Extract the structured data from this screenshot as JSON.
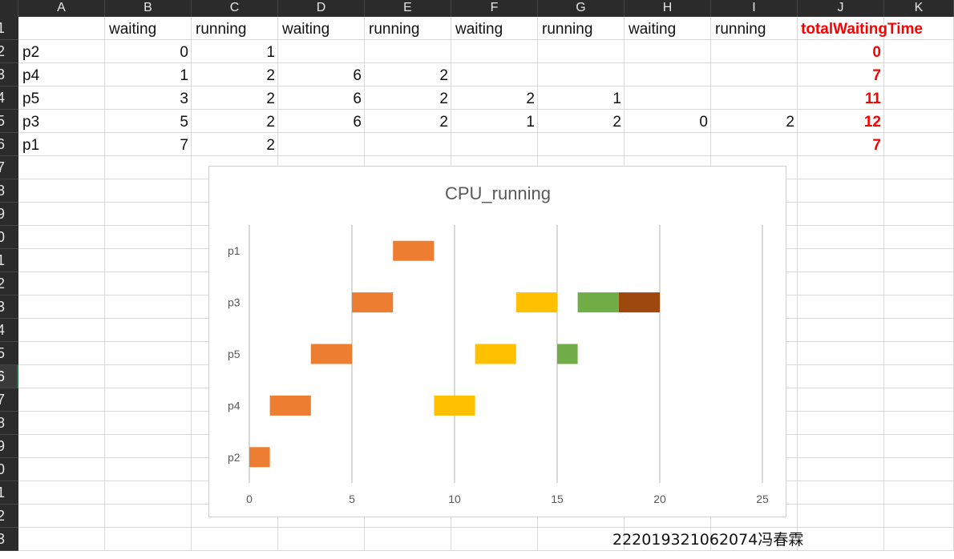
{
  "columns": [
    "A",
    "B",
    "C",
    "D",
    "E",
    "F",
    "G",
    "H",
    "I",
    "J",
    "K"
  ],
  "rows": [
    "1",
    "2",
    "3",
    "4",
    "5",
    "6",
    "7",
    "8",
    "9",
    "0",
    "1",
    "2",
    "3",
    "4",
    "5",
    "6",
    "7",
    "8",
    "9",
    "0",
    "1",
    "2",
    "3"
  ],
  "header_row": [
    "",
    "waiting",
    "running",
    "waiting",
    "running",
    "waiting",
    "running",
    "waiting",
    "running",
    "totalWaitingTime"
  ],
  "table": [
    {
      "name": "p2",
      "values": [
        "0",
        "1",
        "",
        "",
        "",
        "",
        "",
        ""
      ],
      "total": "0"
    },
    {
      "name": "p4",
      "values": [
        "1",
        "2",
        "6",
        "2",
        "",
        "",
        "",
        ""
      ],
      "total": "7"
    },
    {
      "name": "p5",
      "values": [
        "3",
        "2",
        "6",
        "2",
        "2",
        "1",
        "",
        ""
      ],
      "total": "11"
    },
    {
      "name": "p3",
      "values": [
        "5",
        "2",
        "6",
        "2",
        "1",
        "2",
        "0",
        "2"
      ],
      "total": "12"
    },
    {
      "name": "p1",
      "values": [
        "7",
        "2",
        "",
        "",
        "",
        "",
        "",
        ""
      ],
      "total": "7"
    }
  ],
  "signature": "222019321062074冯春霖",
  "colors": {
    "c1": "#ED7D31",
    "c2": "#FFC000",
    "c3": "#70AD47",
    "c4": "#9E480E",
    "total": "#FF0000"
  },
  "chart_data": {
    "type": "bar",
    "orientation": "horizontal-stacked",
    "title": "CPU_running",
    "categories": [
      "p2",
      "p4",
      "p5",
      "p3",
      "p1"
    ],
    "xlim": [
      0,
      25
    ],
    "xticks": [
      "0",
      "5",
      "10",
      "15",
      "20",
      "25"
    ],
    "grid": true,
    "legend": "none",
    "segments": [
      {
        "category": "p2",
        "start": 0,
        "duration": 1,
        "color": "#ED7D31"
      },
      {
        "category": "p4",
        "start": 1,
        "duration": 2,
        "color": "#ED7D31"
      },
      {
        "category": "p4",
        "start": 9,
        "duration": 2,
        "color": "#FFC000"
      },
      {
        "category": "p5",
        "start": 3,
        "duration": 2,
        "color": "#ED7D31"
      },
      {
        "category": "p5",
        "start": 11,
        "duration": 2,
        "color": "#FFC000"
      },
      {
        "category": "p5",
        "start": 15,
        "duration": 1,
        "color": "#70AD47"
      },
      {
        "category": "p3",
        "start": 5,
        "duration": 2,
        "color": "#ED7D31"
      },
      {
        "category": "p3",
        "start": 13,
        "duration": 2,
        "color": "#FFC000"
      },
      {
        "category": "p3",
        "start": 16,
        "duration": 2,
        "color": "#70AD47"
      },
      {
        "category": "p3",
        "start": 18,
        "duration": 2,
        "color": "#9E480E"
      },
      {
        "category": "p1",
        "start": 7,
        "duration": 2,
        "color": "#ED7D31"
      }
    ]
  }
}
